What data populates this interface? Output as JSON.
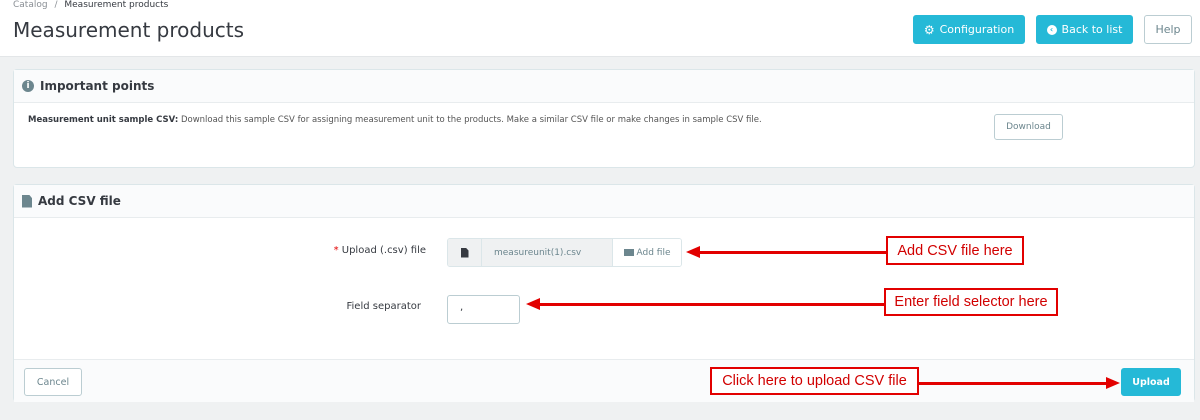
{
  "breadcrumb": {
    "parent": "Catalog",
    "separator": "/",
    "current": "Measurement products"
  },
  "page_title": "Measurement products",
  "toolbar": {
    "configuration": "Configuration",
    "back_to_list": "Back to list",
    "help": "Help"
  },
  "important_panel": {
    "title": "Important points",
    "note_label": "Measurement unit sample CSV:",
    "note_text": " Download this sample CSV for assigning measurement unit to the products. Make a similar CSV file or make changes in sample CSV file.",
    "download": "Download"
  },
  "csv_panel": {
    "title": "Add CSV file",
    "upload_required": "*",
    "upload_label": "Upload (.csv) file",
    "file_name": "measureunit(1).csv",
    "add_file": "Add file",
    "separator_label": "Field separator",
    "separator_value": ",",
    "cancel": "Cancel",
    "upload": "Upload"
  },
  "annotations": {
    "add_csv": "Add CSV file here",
    "field_selector": "Enter field selector here",
    "upload": "Click here to upload CSV file"
  },
  "colors": {
    "accent": "#25b9d7",
    "annotation": "#e20000"
  }
}
